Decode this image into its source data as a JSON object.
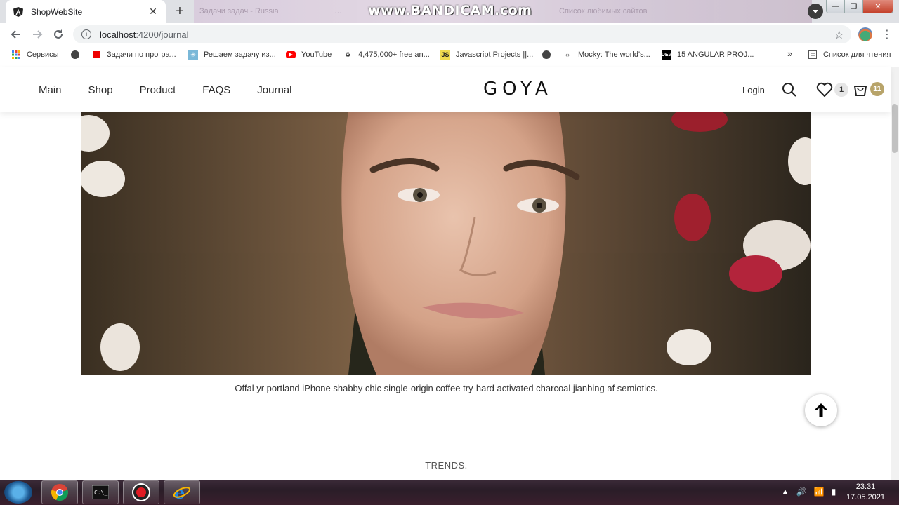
{
  "browser": {
    "tab_title": "ShopWebSite",
    "ghost_tabs": [
      "Задачи задач - Russia",
      "…",
      "Список любимых сайтов"
    ],
    "watermark": "www.BANDICAM.com",
    "url_host": "localhost",
    "url_path": ":4200/journal"
  },
  "bookmarks": [
    {
      "label": "Сервисы",
      "icon": "apps-grid-icon"
    },
    {
      "label": "Задачи по програ...",
      "icon": "red-square-icon"
    },
    {
      "label": "Решаем задачу из...",
      "icon": "snowflake-icon"
    },
    {
      "label": "YouTube",
      "icon": "youtube-icon"
    },
    {
      "label": "4,475,000+ free an...",
      "icon": "recycle-icon"
    },
    {
      "label": "Javascript Projects ||...",
      "icon": "js-icon"
    },
    {
      "label": "Mocky: The world's...",
      "icon": "code-icon"
    },
    {
      "label": "15 ANGULAR PROJ...",
      "icon": "dev-icon"
    },
    {
      "label": "»",
      "icon": "overflow-chevron-icon"
    },
    {
      "label": "Список для чтения",
      "icon": "reading-list-icon"
    }
  ],
  "site": {
    "nav": [
      "Main",
      "Shop",
      "Product",
      "FAQS",
      "Journal"
    ],
    "logo": "GOYA",
    "login": "Login",
    "wishlist_count": "1",
    "cart_count": "11",
    "accent_color": "#b8a46a"
  },
  "content": {
    "hero_alt": "portrait",
    "caption": "Offal yr portland iPhone shabby chic single-origin coffee try-hard activated charcoal jianbing af semiotics.",
    "section_title": "TRENDS."
  },
  "taskbar": {
    "time": "23:31",
    "date": "17.05.2021"
  }
}
